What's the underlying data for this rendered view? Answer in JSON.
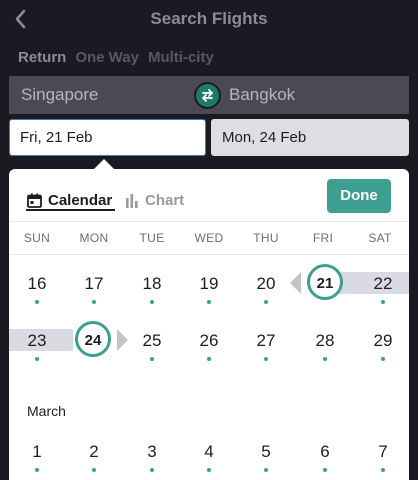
{
  "header": {
    "title": "Search Flights"
  },
  "trip_types": [
    {
      "label": "Return",
      "active": true
    },
    {
      "label": "One Way",
      "active": false
    },
    {
      "label": "Multi-city",
      "active": false
    }
  ],
  "route": {
    "from": "Singapore",
    "to": "Bangkok"
  },
  "dates": {
    "depart": "Fri, 21 Feb",
    "return": "Mon, 24 Feb"
  },
  "calendar": {
    "tabs": {
      "calendar": "Calendar",
      "chart": "Chart"
    },
    "done_label": "Done",
    "weekdays": [
      "SUN",
      "MON",
      "TUE",
      "WED",
      "THU",
      "FRI",
      "SAT"
    ],
    "week1": [
      "16",
      "17",
      "18",
      "19",
      "20",
      "21",
      "22"
    ],
    "week2": [
      "23",
      "24",
      "25",
      "26",
      "27",
      "28",
      "29"
    ],
    "march_label": "March",
    "march_week1": [
      "1",
      "2",
      "3",
      "4",
      "5",
      "6",
      "7"
    ],
    "selected_depart": "21",
    "selected_return": "24"
  },
  "colors": {
    "accent": "#3c9f90",
    "background": "#1b1a23",
    "range": "#dadae3"
  }
}
